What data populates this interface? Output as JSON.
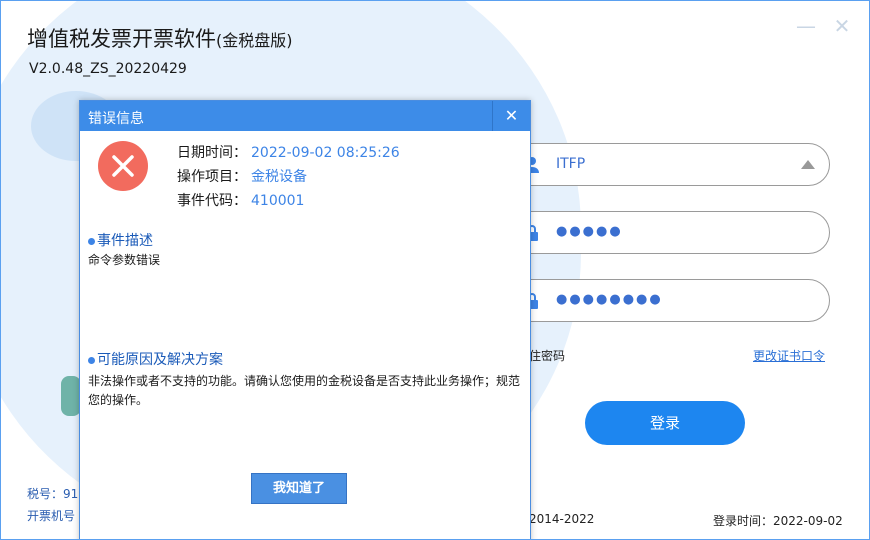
{
  "app": {
    "title_main": "增值税发票开票软件",
    "title_sub": "(金税盘版)",
    "version": "V2.0.48_ZS_20220429",
    "min_glyph": "—",
    "close_glyph": "✕"
  },
  "login": {
    "user_value": "ITFP",
    "pin_value": "●●●●●",
    "password_value": "●●●●●●●●",
    "remember_label": "住密码",
    "change_pin_link": "更改证书口令",
    "login_button": "登录"
  },
  "footer": {
    "tax_no_label": "税号：91",
    "machine_no_label": "开票机号",
    "copyright": "2014-2022",
    "login_time": "登录时间：2022-09-02"
  },
  "dialog": {
    "title": "错误信息",
    "close_glyph": "✕",
    "date_label": "日期时间：",
    "date_value": "2022-09-02 08:25:26",
    "item_label": "操作项目：",
    "item_value": "金税设备",
    "code_label": "事件代码：",
    "code_value": "410001",
    "desc_title": "事件描述",
    "desc_text": "命令参数错误",
    "cause_title": "可能原因及解决方案",
    "cause_text": "非法操作或者不支持的功能。请确认您使用的金税设备是否支持此业务操作；规范您的操作。",
    "ok_button": "我知道了"
  },
  "colors": {
    "accent": "#1d86f0",
    "dialog_header": "#3d8ce8",
    "error_icon": "#f26b5e",
    "value_text": "#3d84e6"
  },
  "icons": [
    "user-icon",
    "lock-icon",
    "error-x-icon",
    "close-icon",
    "minimize-icon",
    "dropdown-arrow-icon"
  ]
}
